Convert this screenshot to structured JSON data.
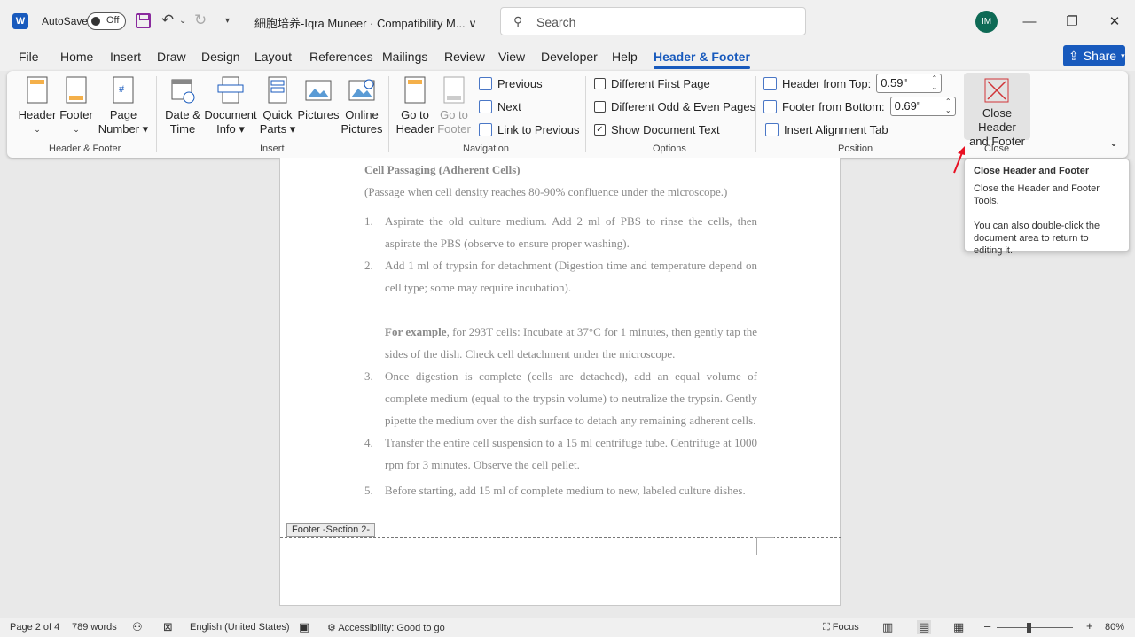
{
  "titlebar": {
    "app_logo": "W",
    "autosave_label": "AutoSave",
    "autosave_state": "Off",
    "doc_title": "細胞培养-Iqra Muneer  ·  Compatibility M... ∨",
    "search_placeholder": "Search",
    "avatar_initials": "IM"
  },
  "tabs": [
    "File",
    "Home",
    "Insert",
    "Draw",
    "Design",
    "Layout",
    "References",
    "Mailings",
    "Review",
    "View",
    "Developer",
    "Help",
    "Header & Footer"
  ],
  "share_label": "Share",
  "ribbon": {
    "hf_group": {
      "header": "Header",
      "footer": "Footer",
      "page_number_1": "Page",
      "page_number_2": "Number",
      "label": "Header & Footer"
    },
    "insert_group": {
      "date_time_1": "Date &",
      "date_time_2": "Time",
      "doc_info_1": "Document",
      "doc_info_2": "Info",
      "quick_parts_1": "Quick",
      "quick_parts_2": "Parts",
      "pictures": "Pictures",
      "online_pictures_1": "Online",
      "online_pictures_2": "Pictures",
      "label": "Insert"
    },
    "nav_group": {
      "goto_header_1": "Go to",
      "goto_header_2": "Header",
      "goto_footer_1": "Go to",
      "goto_footer_2": "Footer",
      "previous": "Previous",
      "next": "Next",
      "link_prev": "Link to Previous",
      "label": "Navigation"
    },
    "options_group": {
      "diff_first": "Different First Page",
      "diff_odd_even": "Different Odd & Even Pages",
      "show_doc_text": "Show Document Text",
      "label": "Options"
    },
    "position_group": {
      "header_from_top": "Header from Top:",
      "header_value": "0.59\"",
      "footer_from_bottom": "Footer from Bottom:",
      "footer_value": "0.69\"",
      "insert_align_tab": "Insert Alignment Tab",
      "label": "Position"
    },
    "close_group": {
      "close_1": "Close Header",
      "close_2": "and Footer",
      "label": "Close"
    }
  },
  "tooltip": {
    "title": "Close Header and Footer",
    "line1": "Close the Header and Footer Tools.",
    "line2": "You can also double-click the document area to return to editing it."
  },
  "document": {
    "heading": "Cell Passaging (Adherent Cells)",
    "subheading": "(Passage when cell density reaches 80-90% confluence under the microscope.)",
    "items": [
      {
        "num": "1.",
        "text": "Aspirate the old culture medium. Add 2 ml of PBS to rinse the cells, then aspirate the PBS (observe to ensure proper washing)."
      },
      {
        "num": "2.",
        "text": "Add 1 ml of trypsin for detachment (Digestion time and temperature depend on cell type; some may require incubation)."
      },
      {
        "num": "3.",
        "text": "Once digestion is complete (cells are detached), add an equal volume of complete medium (equal to the trypsin volume) to neutralize the trypsin. Gently pipette the medium over the dish surface to detach any remaining adherent cells."
      },
      {
        "num": "4.",
        "text": "Transfer the entire cell suspension to a 15 ml centrifuge tube. Centrifuge at 1000 rpm for 3 minutes. Observe the cell pellet."
      },
      {
        "num": "5.",
        "text": "Before starting, add 15 ml of complete medium to new, labeled culture dishes."
      }
    ],
    "example_bold": "For example",
    "example_rest": ", for 293T cells: Incubate at 37°C for 1 minutes, then gently tap the sides of the dish. Check cell detachment under the microscope.",
    "footer_tag": "Footer -Section 2-"
  },
  "statusbar": {
    "page": "Page 2 of 4",
    "words": "789 words",
    "language": "English (United States)",
    "accessibility": "Accessibility: Good to go",
    "focus": "Focus",
    "zoom": "80%",
    "zoom_level_percent": 80
  },
  "colors": {
    "accent": "#185abd",
    "close_icon": "#d13438",
    "arrow": "#e81123"
  }
}
